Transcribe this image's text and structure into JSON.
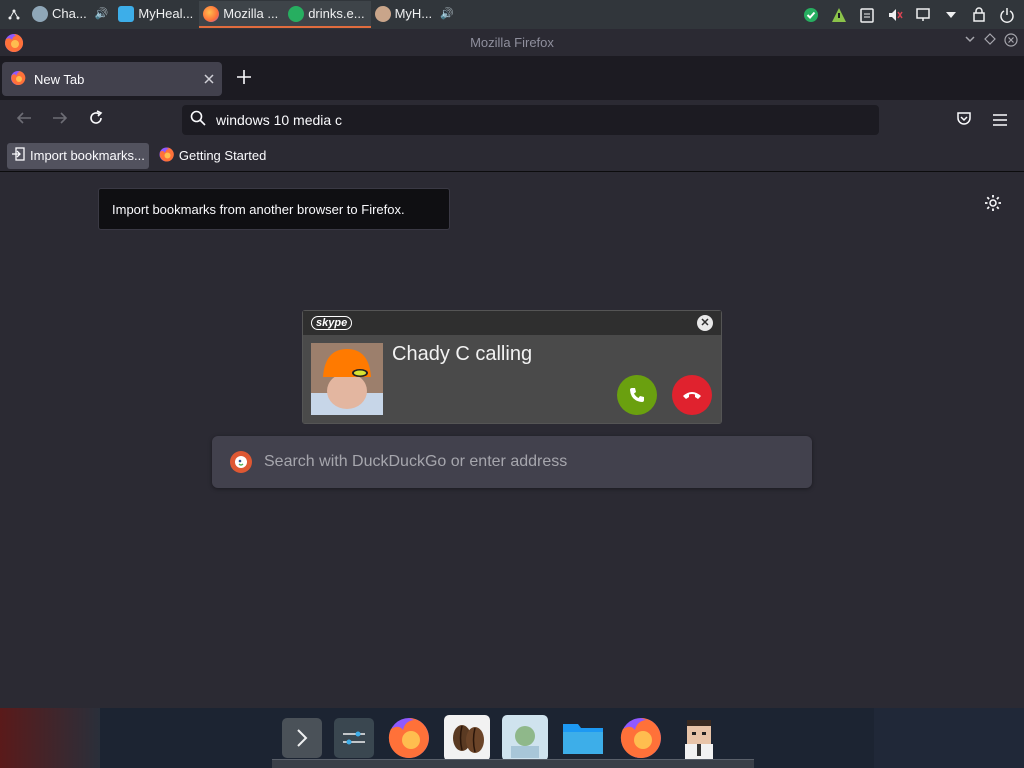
{
  "system_bar": {
    "tasks": [
      {
        "label": "Cha...",
        "icon": "app-icon",
        "has_audio": true,
        "active": false
      },
      {
        "label": "MyHeal...",
        "icon": "folder-icon",
        "has_audio": false,
        "active": false
      },
      {
        "label": "Mozilla ...",
        "icon": "firefox-icon",
        "has_audio": false,
        "active": true
      },
      {
        "label": "drinks.e...",
        "icon": "app-icon",
        "has_audio": false,
        "active": true
      },
      {
        "label": "MyH...",
        "icon": "avatar-icon",
        "has_audio": true,
        "active": false
      }
    ],
    "speaker_glyph": "🔊"
  },
  "window": {
    "title": "Mozilla Firefox"
  },
  "tabs": [
    {
      "label": "New Tab"
    }
  ],
  "nav": {
    "url_value": "windows 10 media c"
  },
  "bookmarks": [
    {
      "label": "Import bookmarks..."
    },
    {
      "label": "Getting Started"
    }
  ],
  "content": {
    "tooltip": "Import bookmarks from another browser to Firefox.",
    "search_placeholder": "Search with DuckDuckGo or enter address"
  },
  "skype": {
    "logo_text": "skype",
    "caller_text": "Chady C calling"
  },
  "colors": {
    "accept": "#6aa00f",
    "decline": "#e0222e",
    "firefox_orange": "#ff7139"
  }
}
